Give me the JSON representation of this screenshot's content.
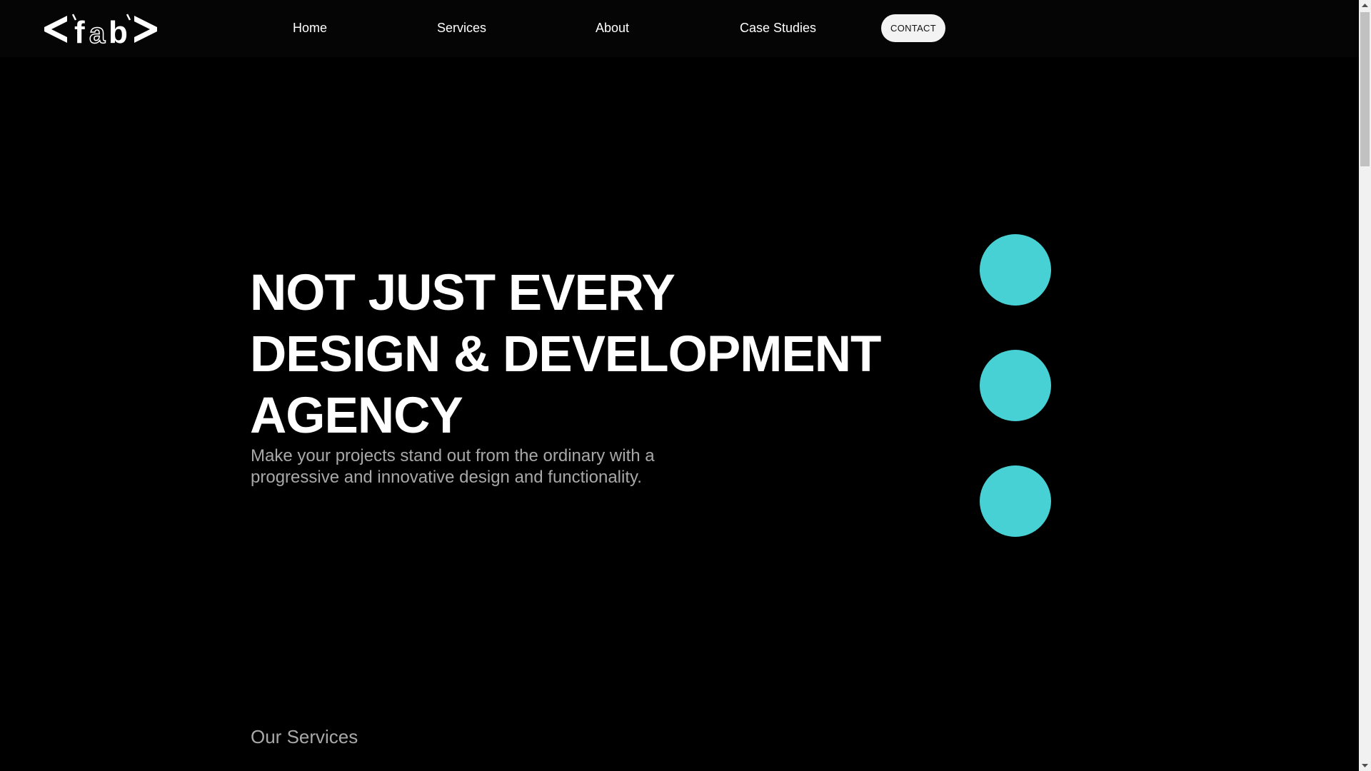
{
  "header": {
    "logo": {
      "text": "<'fab'>",
      "icon": "fab-logo"
    },
    "nav": [
      {
        "label": "Home"
      },
      {
        "label": "Services"
      },
      {
        "label": "About"
      },
      {
        "label": "Case Studies"
      }
    ],
    "contact_label": "CONTACT"
  },
  "hero": {
    "title_lines": [
      "NOT JUST EVERY",
      "DESIGN & DEVELOPMENT",
      "AGENCY"
    ],
    "subtitle": "Make your projects stand out from the ordinary with a progressive and innovative design and functionality."
  },
  "services_section": {
    "label": "Our Services"
  },
  "colors": {
    "background": "#000000",
    "accent": "#48D1D4",
    "text": "#FFFFFF",
    "muted_text": "#A8A8A8",
    "button_bg": "#F3F3F3"
  },
  "decor": {
    "circles_count": 3,
    "circle_icon": "teal-circle"
  }
}
